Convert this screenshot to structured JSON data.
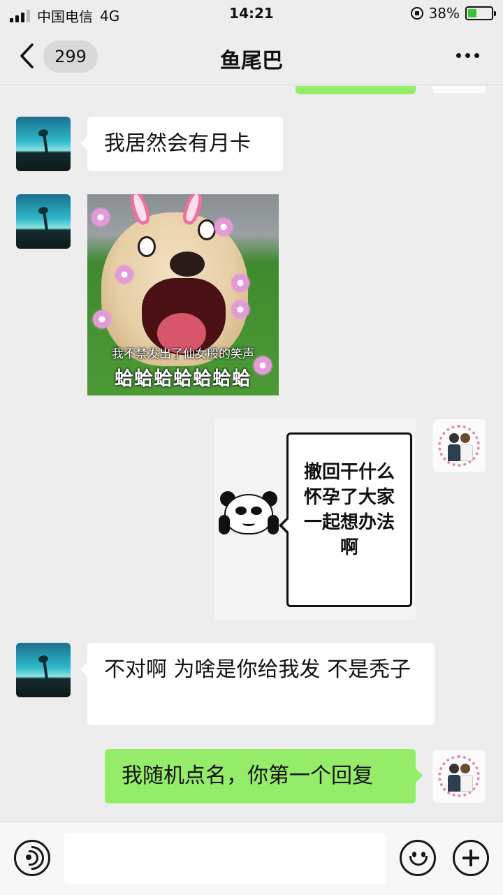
{
  "status_bar": {
    "carrier": "中国电信",
    "network": "4G",
    "time": "14:21",
    "battery_percent": "38%",
    "battery_level": 0.38,
    "icons": [
      "signal-icon",
      "rotation-lock-icon",
      "battery-charging-icon"
    ]
  },
  "nav": {
    "unread_count": "299",
    "title": "鱼尾巴",
    "icons": [
      "back-arrow-icon",
      "more-options-icon"
    ]
  },
  "messages": [
    {
      "side": "left",
      "type": "text",
      "text": "我居然会有月卡"
    },
    {
      "side": "left",
      "type": "sticker",
      "caption_line1": "我不禁发出了仙女般的笑声",
      "caption_line2": "蛤蛤蛤蛤蛤蛤蛤"
    },
    {
      "side": "right",
      "type": "sticker",
      "text": "撤回干什么 怀孕了大家一起想办法啊"
    },
    {
      "side": "left",
      "type": "text",
      "text": "不对啊 为啥是你给我发 不是秃子"
    },
    {
      "side": "right",
      "type": "text",
      "text": "我随机点名，你第一个回复"
    }
  ],
  "input_bar": {
    "icons": [
      "voice-icon",
      "emoji-icon",
      "plus-icon"
    ]
  },
  "colors": {
    "background": "#ededed",
    "my_bubble": "#95ec69",
    "their_bubble": "#ffffff",
    "battery_fill": "#3cc33c"
  }
}
